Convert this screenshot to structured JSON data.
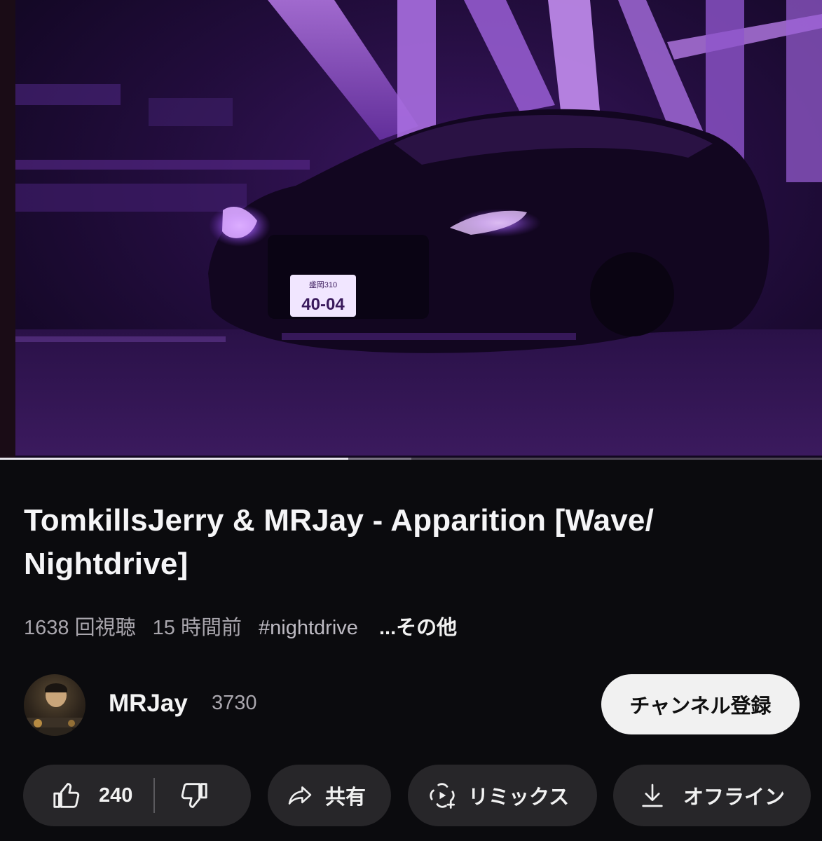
{
  "player": {
    "progress_played": 0.424,
    "progress_buffered": 0.5
  },
  "video": {
    "title_line1": "TomkillsJerry & MRJay - Apparition [Wave/",
    "title_line2": "Nightdrive]",
    "views": "1638 回視聴",
    "age": "15 時間前",
    "hashtag": "#nightdrive",
    "more": "...その他"
  },
  "channel": {
    "name": "MRJay",
    "subscribers": "3730",
    "subscribe_label": "チャンネル登録"
  },
  "actions": {
    "like_count": "240",
    "share_label": "共有",
    "remix_label": "リミックス",
    "offline_label": "オフライン"
  },
  "colors": {
    "accent_purple": "#6d2fb8",
    "pill_bg": "#272629",
    "subscribe_bg": "#f1f1f1"
  }
}
